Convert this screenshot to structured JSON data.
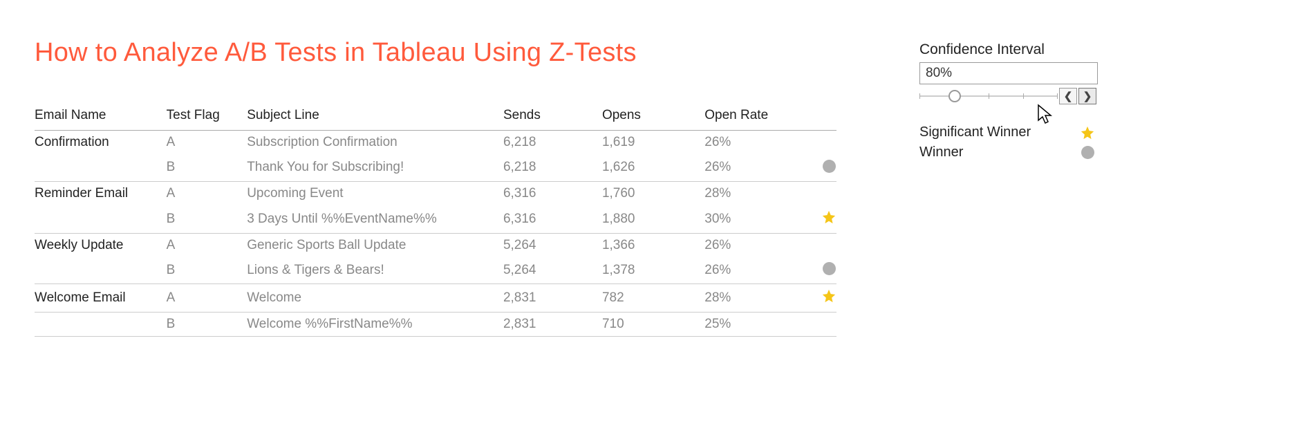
{
  "title": "How to Analyze A/B Tests in Tableau Using Z-Tests",
  "headers": {
    "email_name": "Email Name",
    "test_flag": "Test Flag",
    "subject_line": "Subject Line",
    "sends": "Sends",
    "opens": "Opens",
    "open_rate": "Open Rate"
  },
  "rows": [
    {
      "email_name": "Confirmation",
      "flag": "A",
      "subject": "Subscription Confirmation",
      "sends": "6,218",
      "opens": "1,619",
      "rate": "26%",
      "winner": ""
    },
    {
      "email_name": "",
      "flag": "B",
      "subject": "Thank You for Subscribing!",
      "sends": "6,218",
      "opens": "1,626",
      "rate": "26%",
      "winner": "circle"
    },
    {
      "email_name": "Reminder Email",
      "flag": "A",
      "subject": "Upcoming Event",
      "sends": "6,316",
      "opens": "1,760",
      "rate": "28%",
      "winner": ""
    },
    {
      "email_name": "",
      "flag": "B",
      "subject": "3 Days Until %%EventName%%",
      "sends": "6,316",
      "opens": "1,880",
      "rate": "30%",
      "winner": "star"
    },
    {
      "email_name": "Weekly Update",
      "flag": "A",
      "subject": "Generic Sports Ball Update",
      "sends": "5,264",
      "opens": "1,366",
      "rate": "26%",
      "winner": ""
    },
    {
      "email_name": "",
      "flag": "B",
      "subject": "Lions & Tigers & Bears!",
      "sends": "5,264",
      "opens": "1,378",
      "rate": "26%",
      "winner": "circle"
    },
    {
      "email_name": "Welcome Email",
      "flag": "A",
      "subject": "Welcome",
      "sends": "2,831",
      "opens": "782",
      "rate": "28%",
      "winner": "star"
    },
    {
      "email_name": "",
      "flag": "B",
      "subject": "Welcome %%FirstName%%",
      "sends": "2,831",
      "opens": "710",
      "rate": "25%",
      "winner": ""
    }
  ],
  "confidence": {
    "label": "Confidence Interval",
    "value": "80%"
  },
  "legend": {
    "significant": "Significant Winner",
    "winner": "Winner"
  },
  "colors": {
    "accent": "#ff5a3c",
    "star": "#f5c518",
    "circle": "#b0b0b0"
  }
}
